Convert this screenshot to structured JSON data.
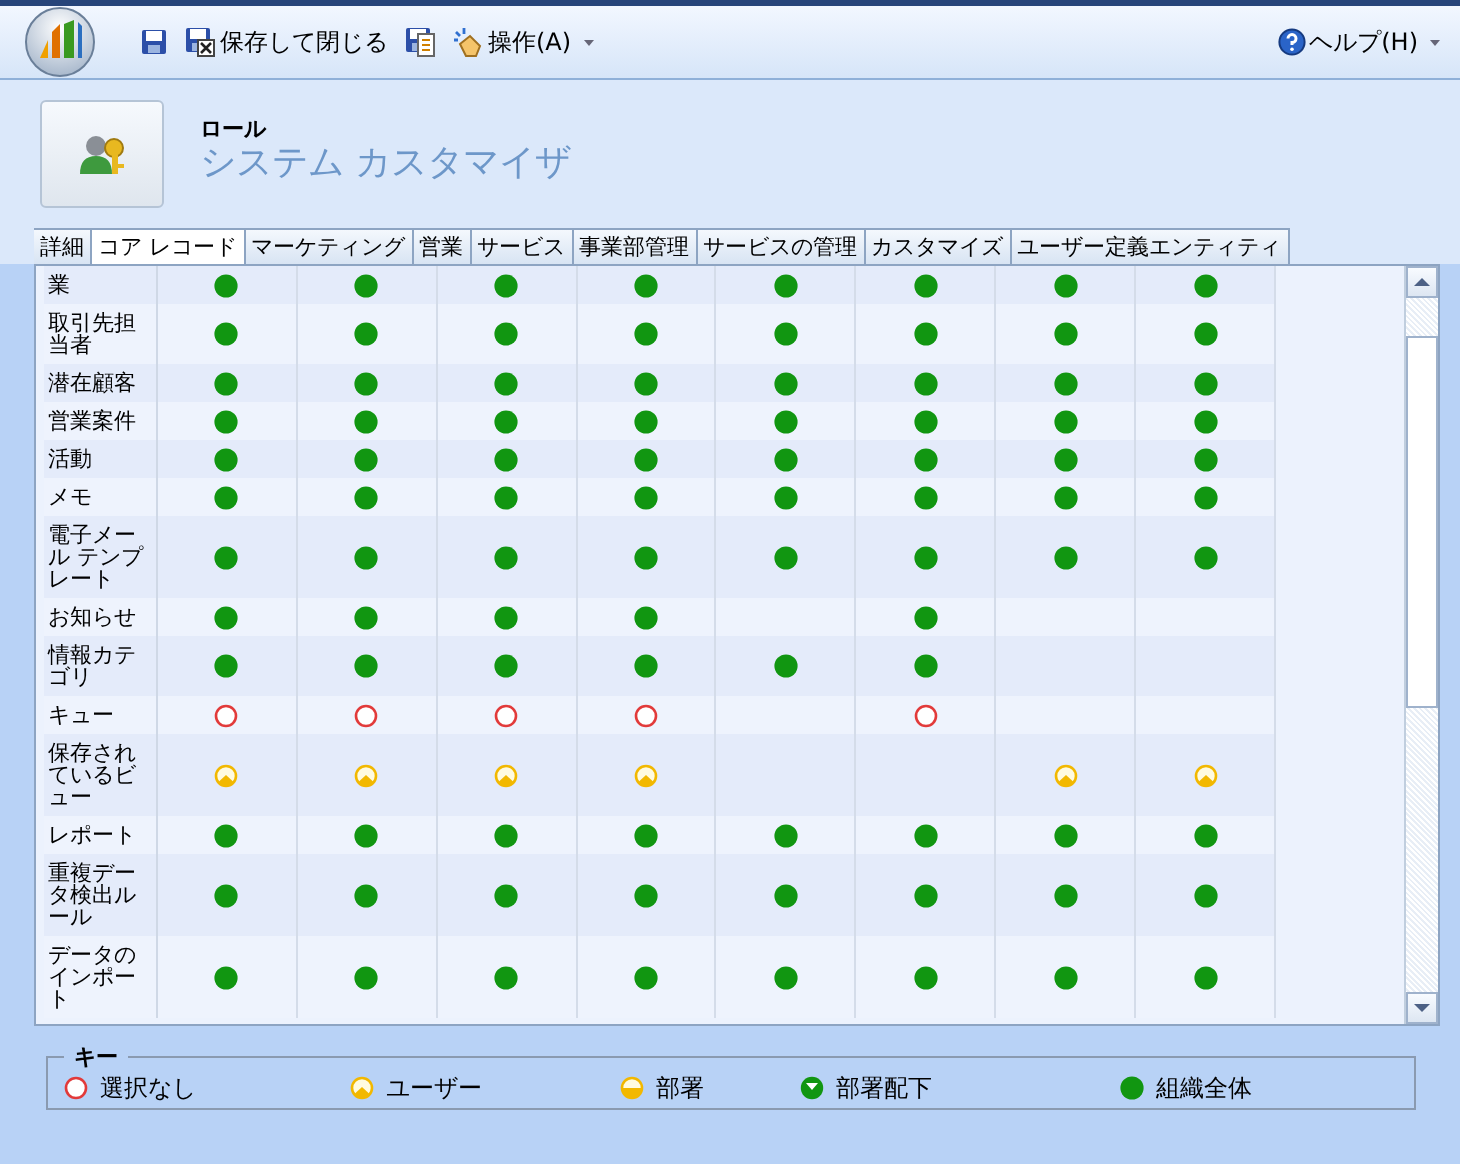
{
  "toolbar": {
    "save_close": "保存して閉じる",
    "actions": "操作(A)",
    "help": "ヘルプ(H)"
  },
  "header": {
    "entity": "ロール",
    "title": "システム カスタマイザ"
  },
  "tabs": [
    {
      "label": "詳細",
      "selected": false
    },
    {
      "label": "コア レコード",
      "selected": true
    },
    {
      "label": "マーケティング",
      "selected": false
    },
    {
      "label": "営業",
      "selected": false
    },
    {
      "label": "サービス",
      "selected": false
    },
    {
      "label": "事業部管理",
      "selected": false
    },
    {
      "label": "サービスの管理",
      "selected": false
    },
    {
      "label": "カスタマイズ",
      "selected": false
    },
    {
      "label": "ユーザー定義エンティティ",
      "selected": false
    }
  ],
  "grid": {
    "rows": [
      {
        "name": "業",
        "cells": [
          {
            "kind": "organization"
          },
          {
            "kind": "organization"
          },
          {
            "kind": "organization"
          },
          {
            "kind": "organization"
          },
          {
            "kind": "organization"
          },
          {
            "kind": "organization"
          },
          {
            "kind": "organization"
          },
          {
            "kind": "organization"
          }
        ]
      },
      {
        "name": "取引先担当者",
        "cells": [
          {
            "kind": "organization"
          },
          {
            "kind": "organization"
          },
          {
            "kind": "organization"
          },
          {
            "kind": "organization"
          },
          {
            "kind": "organization"
          },
          {
            "kind": "organization"
          },
          {
            "kind": "organization"
          },
          {
            "kind": "organization"
          }
        ]
      },
      {
        "name": "潜在顧客",
        "cells": [
          {
            "kind": "organization"
          },
          {
            "kind": "organization"
          },
          {
            "kind": "organization"
          },
          {
            "kind": "organization"
          },
          {
            "kind": "organization"
          },
          {
            "kind": "organization"
          },
          {
            "kind": "organization"
          },
          {
            "kind": "organization"
          }
        ]
      },
      {
        "name": "営業案件",
        "cells": [
          {
            "kind": "organization"
          },
          {
            "kind": "organization"
          },
          {
            "kind": "organization"
          },
          {
            "kind": "organization"
          },
          {
            "kind": "organization"
          },
          {
            "kind": "organization"
          },
          {
            "kind": "organization"
          },
          {
            "kind": "organization"
          }
        ]
      },
      {
        "name": "活動",
        "cells": [
          {
            "kind": "organization"
          },
          {
            "kind": "organization"
          },
          {
            "kind": "organization"
          },
          {
            "kind": "organization"
          },
          {
            "kind": "organization"
          },
          {
            "kind": "organization"
          },
          {
            "kind": "organization"
          },
          {
            "kind": "organization"
          }
        ]
      },
      {
        "name": "メモ",
        "cells": [
          {
            "kind": "organization"
          },
          {
            "kind": "organization"
          },
          {
            "kind": "organization"
          },
          {
            "kind": "organization"
          },
          {
            "kind": "organization"
          },
          {
            "kind": "organization"
          },
          {
            "kind": "organization"
          },
          {
            "kind": "organization"
          }
        ]
      },
      {
        "name": "電子メール テンプレート",
        "cells": [
          {
            "kind": "organization"
          },
          {
            "kind": "organization"
          },
          {
            "kind": "organization"
          },
          {
            "kind": "organization"
          },
          {
            "kind": "organization"
          },
          {
            "kind": "organization"
          },
          {
            "kind": "organization"
          },
          {
            "kind": "organization"
          }
        ]
      },
      {
        "name": "お知らせ",
        "cells": [
          {
            "kind": "organization"
          },
          {
            "kind": "organization"
          },
          {
            "kind": "organization"
          },
          {
            "kind": "organization"
          },
          {
            "kind": "blank"
          },
          {
            "kind": "organization"
          },
          {
            "kind": "blank"
          },
          {
            "kind": "blank"
          }
        ]
      },
      {
        "name": "情報カテゴリ",
        "cells": [
          {
            "kind": "organization"
          },
          {
            "kind": "organization"
          },
          {
            "kind": "organization"
          },
          {
            "kind": "organization"
          },
          {
            "kind": "organization"
          },
          {
            "kind": "organization"
          },
          {
            "kind": "blank"
          },
          {
            "kind": "blank"
          }
        ]
      },
      {
        "name": "キュー",
        "cells": [
          {
            "kind": "none"
          },
          {
            "kind": "none"
          },
          {
            "kind": "none"
          },
          {
            "kind": "none"
          },
          {
            "kind": "blank"
          },
          {
            "kind": "none"
          },
          {
            "kind": "blank"
          },
          {
            "kind": "blank"
          }
        ]
      },
      {
        "name": "保存されているビュー",
        "cells": [
          {
            "kind": "user"
          },
          {
            "kind": "user"
          },
          {
            "kind": "user"
          },
          {
            "kind": "user"
          },
          {
            "kind": "blank"
          },
          {
            "kind": "blank"
          },
          {
            "kind": "user"
          },
          {
            "kind": "user"
          }
        ]
      },
      {
        "name": "レポート",
        "cells": [
          {
            "kind": "organization"
          },
          {
            "kind": "organization"
          },
          {
            "kind": "organization"
          },
          {
            "kind": "organization"
          },
          {
            "kind": "organization"
          },
          {
            "kind": "organization"
          },
          {
            "kind": "organization"
          },
          {
            "kind": "organization"
          }
        ]
      },
      {
        "name": "重複データ検出ルール",
        "cells": [
          {
            "kind": "organization"
          },
          {
            "kind": "organization"
          },
          {
            "kind": "organization"
          },
          {
            "kind": "organization"
          },
          {
            "kind": "organization"
          },
          {
            "kind": "organization"
          },
          {
            "kind": "organization"
          },
          {
            "kind": "organization"
          }
        ]
      },
      {
        "name": "データのインポート",
        "cells": [
          {
            "kind": "organization"
          },
          {
            "kind": "organization"
          },
          {
            "kind": "organization"
          },
          {
            "kind": "organization"
          },
          {
            "kind": "organization"
          },
          {
            "kind": "organization"
          },
          {
            "kind": "organization"
          },
          {
            "kind": "organization"
          }
        ]
      }
    ]
  },
  "key": {
    "title": "キー",
    "items": [
      {
        "label": "選択なし",
        "kind": "none"
      },
      {
        "label": "ユーザー",
        "kind": "user"
      },
      {
        "label": "部署",
        "kind": "business_unit"
      },
      {
        "label": "部署配下",
        "kind": "parent_child"
      },
      {
        "label": "組織全体",
        "kind": "organization"
      }
    ]
  }
}
